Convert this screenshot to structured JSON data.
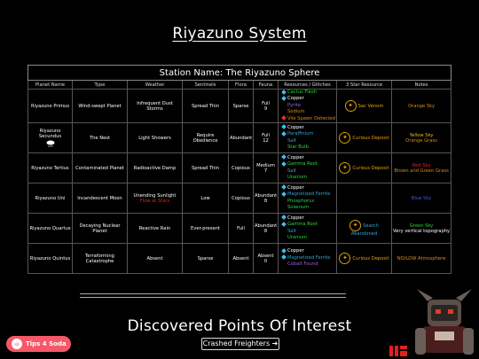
{
  "header": {
    "title": "Riyazuno System"
  },
  "table": {
    "caption": "Station Name: The Riyazuno Sphere",
    "columns": [
      "Planet Name",
      "Type",
      "Weather",
      "Sentinels",
      "Flora",
      "Fauna",
      "Resources / Glitches",
      "3 Star Resource",
      "Notes"
    ],
    "rows": [
      {
        "name": "Riyazuno Primus",
        "type": "Wind-swept Planet",
        "weather": "Infrequent Dust Storms",
        "weather_extra": "",
        "sentinels": "Spread Thin",
        "flora": "Sparse",
        "fauna": "Full",
        "fauna_count": "9",
        "resources": [
          {
            "t": "Cactus Flesh",
            "c": "green",
            "d": "cyan"
          },
          {
            "t": "Copper",
            "c": "white",
            "d": "cyan"
          },
          {
            "t": "Pyrite",
            "c": "purple",
            "d": ""
          },
          {
            "t": "Sodium",
            "c": "orange",
            "d": ""
          },
          {
            "t": "Vile Spawn Detected",
            "c": "orange",
            "d": "red"
          }
        ],
        "star": "Sac Venom",
        "star_color": "amber",
        "notes": [
          {
            "t": "Orange Sky",
            "c": "orange"
          }
        ]
      },
      {
        "name": "Riyazuno Secundus",
        "type": "The Nest",
        "weather": "Light Showers",
        "weather_extra": "",
        "sentinels": "Require Obedience",
        "flora": "Abundant",
        "fauna": "Full",
        "fauna_count": "12",
        "resources": [
          {
            "t": "Copper",
            "c": "white",
            "d": "cyan"
          },
          {
            "t": "Paraffinium",
            "c": "teal",
            "d": "cyan"
          },
          {
            "t": "Salt",
            "c": "teal",
            "d": ""
          },
          {
            "t": "Star Bulb",
            "c": "green",
            "d": ""
          }
        ],
        "star": "Curious Deposit",
        "star_color": "amber",
        "notes": [
          {
            "t": "Yellow Sky",
            "c": "yellow"
          },
          {
            "t": "Orange Grass",
            "c": "orange"
          }
        ]
      },
      {
        "name": "Riyazuno Tertius",
        "type": "Contaminated Planet",
        "weather": "Radioactive Damp",
        "weather_extra": "",
        "sentinels": "Spread Thin",
        "flora": "Copious",
        "fauna": "Medium",
        "fauna_count": "7",
        "resources": [
          {
            "t": "Copper",
            "c": "white",
            "d": "cyan"
          },
          {
            "t": "Gamma Root",
            "c": "green",
            "d": "cyan"
          },
          {
            "t": "Salt",
            "c": "teal",
            "d": ""
          },
          {
            "t": "Uranium",
            "c": "green",
            "d": ""
          }
        ],
        "star": "Curious Deposit",
        "star_color": "amber",
        "notes": [
          {
            "t": "Red Sky",
            "c": "red"
          },
          {
            "t": "Brown and Green Grass",
            "c": "orange"
          }
        ]
      },
      {
        "name": "Riyazuno Uni",
        "type": "Incandescent Moon",
        "weather": "Unending Sunlight",
        "weather_extra": "Flow at Stars",
        "sentinels": "Low",
        "flora": "Copious",
        "fauna": "Abundant",
        "fauna_count": "8",
        "resources": [
          {
            "t": "Copper",
            "c": "white",
            "d": "cyan"
          },
          {
            "t": "Magnetized Ferrite",
            "c": "teal",
            "d": "cyan"
          },
          {
            "t": "Phosphorus",
            "c": "green",
            "d": ""
          },
          {
            "t": "Solanium",
            "c": "green",
            "d": ""
          }
        ],
        "star": "",
        "star_color": "",
        "notes": [
          {
            "t": "Blue Sky",
            "c": "blue"
          }
        ]
      },
      {
        "name": "Riyazuno Quartus",
        "type": "Decaying Nuclear Planet",
        "weather": "Reactive Rain",
        "weather_extra": "",
        "sentinels": "Ever-present",
        "flora": "Full",
        "fauna": "Abundant",
        "fauna_count": "8",
        "resources": [
          {
            "t": "Copper",
            "c": "white",
            "d": "cyan"
          },
          {
            "t": "Gamma Root",
            "c": "green",
            "d": "cyan"
          },
          {
            "t": "Salt",
            "c": "teal",
            "d": ""
          },
          {
            "t": "Uranium",
            "c": "green",
            "d": ""
          }
        ],
        "star": "Search Abandoned",
        "star_color": "teal",
        "notes": [
          {
            "t": "Green Sky",
            "c": "green"
          },
          {
            "t": "Very vertical topography",
            "c": "white"
          }
        ]
      },
      {
        "name": "Riyazuno Quintus",
        "type": "Terraforming Catastrophe",
        "weather": "Absent",
        "weather_extra": "",
        "sentinels": "Sparse",
        "flora": "Absent",
        "fauna": "Absent",
        "fauna_count": "0",
        "resources": [
          {
            "t": "Copper",
            "c": "white",
            "d": "cyan"
          },
          {
            "t": "Magnetized Ferrite",
            "c": "teal",
            "d": "cyan"
          },
          {
            "t": "Cobalt Found",
            "c": "purple",
            "d": ""
          }
        ],
        "star": "Curious Deposit",
        "star_color": "amber",
        "notes": [
          {
            "t": "NO/LOW Atmosphere",
            "c": "orange"
          }
        ]
      }
    ]
  },
  "poi": {
    "title": "Discovered Points Of Interest",
    "link": "Crashed Freighters",
    "link_arrow": "➔"
  },
  "tips": {
    "label": "Tips 4 Soda",
    "icon": "cup-icon"
  },
  "colors": {
    "green": "#2fd63a",
    "purple": "#a35ce0",
    "orange": "#e08a18",
    "yellow": "#e0c020",
    "red": "#e02020",
    "blue": "#3a5ff0",
    "teal": "#3aa0c8",
    "white": "#ffffff",
    "amber": "#f0a000"
  }
}
